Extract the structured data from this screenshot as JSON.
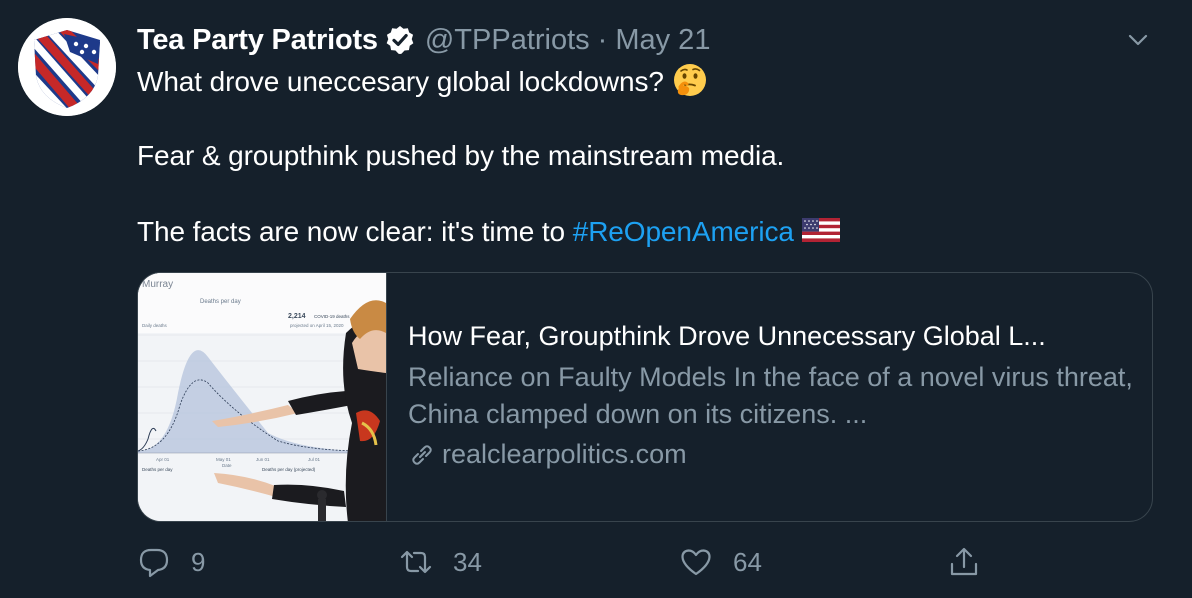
{
  "tweet": {
    "display_name": "Tea Party Patriots",
    "handle": "@TPPatriots",
    "separator": "·",
    "date": "May 21",
    "line1": "What drove uneccesary global lockdowns?",
    "line2": "Fear & groupthink pushed by the mainstream media.",
    "line3_prefix": "The facts are now clear: it's time to ",
    "hashtag": "#ReOpenAmerica",
    "emojis": [
      "thinking-face",
      "us-flag"
    ]
  },
  "card": {
    "title": "How Fear, Groupthink Drove Unnecessary Global L...",
    "description": "Reliance on Faulty Models In the face of a novel virus threat, China clamped down on its citizens. ...",
    "domain": "realclearpolitics.com",
    "image_texts": {
      "name": "Murray",
      "chart_title": "Deaths per day",
      "stat": "2,214",
      "stat_label": "COVID-19 deaths",
      "stat_sub": "projected on April 15, 2020",
      "axis_label": "Daily deaths",
      "x_ticks": [
        "Apr 01",
        "May 01",
        "Jun 01",
        "Jul 01"
      ],
      "x_label": "Date",
      "legend_1": "Deaths per day",
      "legend_2": "Deaths per day (projected)"
    }
  },
  "actions": {
    "reply_count": "9",
    "retweet_count": "34",
    "like_count": "64"
  },
  "colors": {
    "background": "#15202b",
    "border": "#38444d",
    "secondary_text": "#8899a6",
    "link": "#1da1f2"
  }
}
